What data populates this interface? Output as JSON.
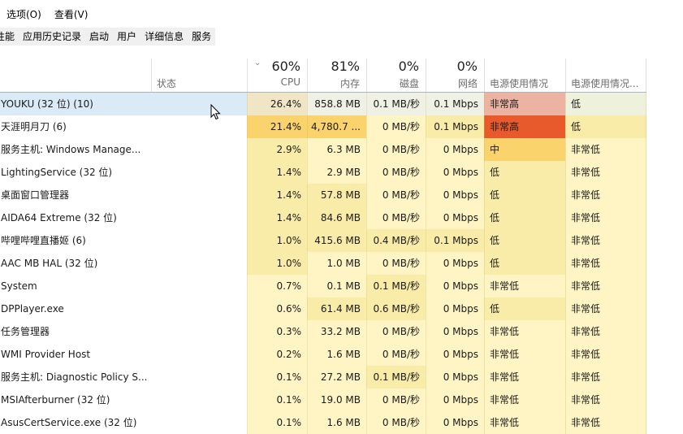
{
  "menu": [
    "选项(O)",
    "查看(V)"
  ],
  "tabs": [
    "性能",
    "应用历史记录",
    "启动",
    "用户",
    "详细信息",
    "服务"
  ],
  "columns": {
    "status": "状态",
    "cpu": {
      "pct": "60%",
      "label": "CPU",
      "sorted": true
    },
    "memory": {
      "pct": "81%",
      "label": "内存"
    },
    "disk": {
      "pct": "0%",
      "label": "磁盘"
    },
    "network": {
      "pct": "0%",
      "label": "网络"
    },
    "power": {
      "label": "电源使用情况"
    },
    "power_trend": {
      "label": "电源使用情况..."
    }
  },
  "colors": {
    "selected_row": "#dbeaf7",
    "heat_light": "#fff4c4",
    "heat_mid": "#f9eca8",
    "heat_strong": "#fbd36c",
    "power_very_high_selected": "#ecb3a3",
    "power_very_high": "#e8592b",
    "power_medium": "#fbd36c"
  },
  "processes": [
    {
      "name": "YOUKU (32 位) (10)",
      "status": "",
      "cpu": "26.4%",
      "memory": "858.8 MB",
      "disk": "0.1 MB/秒",
      "network": "0.1 Mbps",
      "power": "非常高",
      "power_trend": "低",
      "selected": true
    },
    {
      "name": "天涯明月刀 (6)",
      "status": "",
      "cpu": "21.4%",
      "memory": "4,780.7 ...",
      "disk": "0 MB/秒",
      "network": "0.1 Mbps",
      "power": "非常高",
      "power_trend": "低"
    },
    {
      "name": "服务主机: Windows Manage...",
      "status": "",
      "cpu": "2.9%",
      "memory": "6.3 MB",
      "disk": "0 MB/秒",
      "network": "0 Mbps",
      "power": "中",
      "power_trend": "非常低"
    },
    {
      "name": "LightingService (32 位)",
      "status": "",
      "cpu": "1.4%",
      "memory": "2.9 MB",
      "disk": "0 MB/秒",
      "network": "0 Mbps",
      "power": "低",
      "power_trend": "非常低"
    },
    {
      "name": "桌面窗口管理器",
      "status": "",
      "cpu": "1.4%",
      "memory": "57.8 MB",
      "disk": "0 MB/秒",
      "network": "0 Mbps",
      "power": "低",
      "power_trend": "非常低"
    },
    {
      "name": "AIDA64 Extreme (32 位)",
      "status": "",
      "cpu": "1.4%",
      "memory": "84.6 MB",
      "disk": "0 MB/秒",
      "network": "0 Mbps",
      "power": "低",
      "power_trend": "非常低"
    },
    {
      "name": "哔哩哔哩直播姬 (6)",
      "status": "",
      "cpu": "1.0%",
      "memory": "415.6 MB",
      "disk": "0.4 MB/秒",
      "network": "0.1 Mbps",
      "power": "低",
      "power_trend": "非常低"
    },
    {
      "name": "AAC MB HAL (32 位)",
      "status": "",
      "cpu": "1.0%",
      "memory": "1.0 MB",
      "disk": "0 MB/秒",
      "network": "0 Mbps",
      "power": "低",
      "power_trend": "非常低"
    },
    {
      "name": "System",
      "status": "",
      "cpu": "0.7%",
      "memory": "0.1 MB",
      "disk": "0.1 MB/秒",
      "network": "0 Mbps",
      "power": "非常低",
      "power_trend": "非常低"
    },
    {
      "name": "DPPlayer.exe",
      "status": "",
      "cpu": "0.6%",
      "memory": "61.4 MB",
      "disk": "0.6 MB/秒",
      "network": "0 Mbps",
      "power": "低",
      "power_trend": "非常低"
    },
    {
      "name": "任务管理器",
      "status": "",
      "cpu": "0.3%",
      "memory": "33.2 MB",
      "disk": "0 MB/秒",
      "network": "0 Mbps",
      "power": "非常低",
      "power_trend": "非常低"
    },
    {
      "name": "WMI Provider Host",
      "status": "",
      "cpu": "0.2%",
      "memory": "1.6 MB",
      "disk": "0 MB/秒",
      "network": "0 Mbps",
      "power": "非常低",
      "power_trend": "非常低"
    },
    {
      "name": "服务主机: Diagnostic Policy S...",
      "status": "",
      "cpu": "0.1%",
      "memory": "27.2 MB",
      "disk": "0.1 MB/秒",
      "network": "0 Mbps",
      "power": "非常低",
      "power_trend": "非常低"
    },
    {
      "name": "MSIAfterburner (32 位)",
      "status": "",
      "cpu": "0.1%",
      "memory": "19.0 MB",
      "disk": "0 MB/秒",
      "network": "0 Mbps",
      "power": "非常低",
      "power_trend": "非常低"
    },
    {
      "name": "AsusCertService.exe (32 位)",
      "status": "",
      "cpu": "0.1%",
      "memory": "1.6 MB",
      "disk": "0 MB/秒",
      "network": "0 Mbps",
      "power": "非常低",
      "power_trend": "非常低"
    }
  ]
}
